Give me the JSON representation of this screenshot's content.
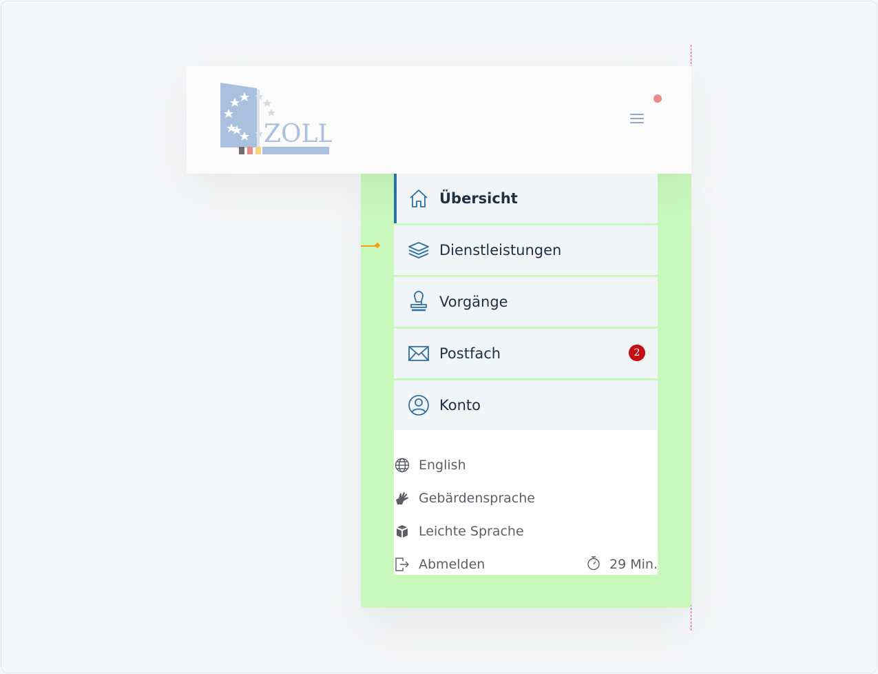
{
  "brand": {
    "logo_text": "ZOLL"
  },
  "colors": {
    "accent": "#2b6ea3",
    "badge": "#c40f12",
    "notification_dot": "#e88b89",
    "panel_highlight": "#c9f8bd"
  },
  "nav": {
    "items": [
      {
        "label": "Übersicht",
        "icon": "home-icon",
        "active": true
      },
      {
        "label": "Dienstleistungen",
        "icon": "layers-icon",
        "active": false
      },
      {
        "label": "Vorgänge",
        "icon": "stamp-icon",
        "active": false
      },
      {
        "label": "Postfach",
        "icon": "mail-icon",
        "active": false,
        "badge": "2"
      },
      {
        "label": "Konto",
        "icon": "user-circle-icon",
        "active": false
      }
    ]
  },
  "utility": {
    "english": "English",
    "sign_language": "Gebärdensprache",
    "easy_language": "Leichte Sprache",
    "logout": "Abmelden",
    "session_time": "29 Min."
  }
}
